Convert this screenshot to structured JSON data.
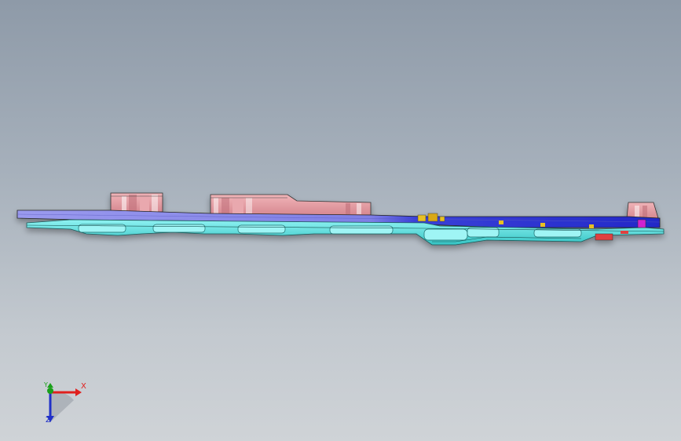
{
  "app": {
    "view": "cad-viewport",
    "background_colors": [
      "#8e9aa8",
      "#cfd3d7"
    ]
  },
  "model": {
    "colors": {
      "base_plate": "#8f8fe8",
      "base_plate_dark": "#2b2fd0",
      "rails": "#5fe3e3",
      "rails_dark": "#1aa6a6",
      "blocks": "#e39aa0",
      "blocks_dark": "#b8686e",
      "accent_yellow": "#e8c020",
      "accent_magenta": "#d020d0",
      "accent_red": "#e04040",
      "outline": "#1a1a1a"
    }
  },
  "triad": {
    "x_label": "X",
    "y_label": "Y",
    "z_label": "Z",
    "x_color": "#e0201e",
    "y_color": "#1aa01a",
    "z_color": "#2030c8"
  }
}
